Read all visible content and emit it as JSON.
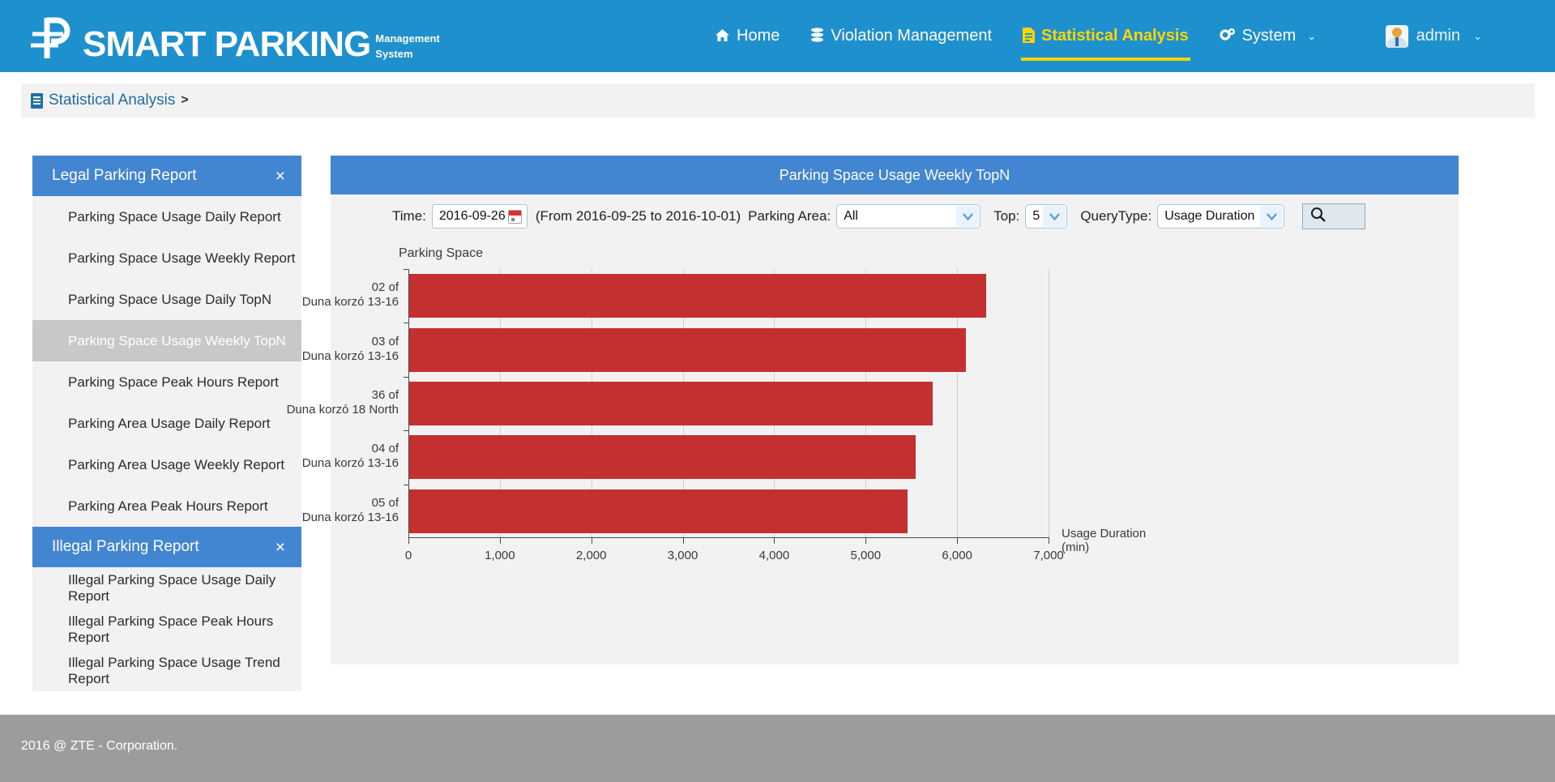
{
  "brand": {
    "title": "SMART PARKING",
    "subtitle_line1": "Management",
    "subtitle_line2": "System",
    "logo_icon": "parking-p-logo-icon"
  },
  "nav": {
    "items": [
      {
        "label": "Home",
        "icon": "home-icon",
        "active": false,
        "caret": ""
      },
      {
        "label": "Violation Management",
        "icon": "database-icon",
        "active": false,
        "caret": ""
      },
      {
        "label": "Statistical Analysis",
        "icon": "document-icon",
        "active": true,
        "caret": ""
      },
      {
        "label": "System",
        "icon": "gears-icon",
        "active": false,
        "caret": "⌄"
      }
    ],
    "user": {
      "name": "admin",
      "caret": "⌄",
      "icon": "user-avatar-icon"
    }
  },
  "breadcrumb": {
    "icon": "document-icon",
    "label": "Statistical Analysis",
    "separator": ">"
  },
  "sidebar": {
    "groups": [
      {
        "title": "Legal Parking Report",
        "close_label": "×",
        "items": [
          {
            "label": "Parking Space Usage Daily Report",
            "selected": false
          },
          {
            "label": "Parking Space Usage Weekly Report",
            "selected": false
          },
          {
            "label": "Parking Space Usage Daily TopN",
            "selected": false
          },
          {
            "label": "Parking Space Usage Weekly TopN",
            "selected": true
          },
          {
            "label": "Parking Space Peak Hours Report",
            "selected": false
          },
          {
            "label": "Parking Area Usage Daily Report",
            "selected": false
          },
          {
            "label": "Parking Area Usage Weekly Report",
            "selected": false
          },
          {
            "label": "Parking Area Peak Hours Report",
            "selected": false
          }
        ]
      },
      {
        "title": "Illegal Parking Report",
        "close_label": "×",
        "items": [
          {
            "label": "Illegal Parking Space Usage Daily Report",
            "selected": false
          },
          {
            "label": "Illegal Parking Space Peak Hours Report",
            "selected": false
          },
          {
            "label": "Illegal Parking Space Usage Trend Report",
            "selected": false
          }
        ]
      }
    ]
  },
  "panel": {
    "title": "Parking Space Usage Weekly TopN",
    "toolbar": {
      "time_label": "Time:",
      "time_value": "2016-09-26",
      "calendar_icon": "calendar-icon",
      "range_text": "(From 2016-09-25 to 2016-10-01)",
      "area_label": "Parking Area:",
      "area_value": "All",
      "top_label": "Top:",
      "top_value": "5",
      "querytype_label": "QueryType:",
      "querytype_value": "Usage Duration",
      "search_icon": "search-icon"
    }
  },
  "chart_data": {
    "type": "bar",
    "orientation": "horizontal",
    "title": "Parking Space Usage Weekly TopN",
    "ylabel": "Parking Space",
    "xlabel": "Usage Duration(min)",
    "xlabel_line1": "Usage Duration",
    "xlabel_line2": "(min)",
    "xlim": [
      0,
      7000
    ],
    "xticks": [
      0,
      1000,
      2000,
      3000,
      4000,
      5000,
      6000,
      7000
    ],
    "xtick_labels": [
      "0",
      "1,000",
      "2,000",
      "3,000",
      "4,000",
      "5,000",
      "6,000",
      "7,000"
    ],
    "grid": true,
    "legend": "none",
    "bar_color": "#c43030",
    "categories": [
      "02 of\nDuna korzó 13-16",
      "03 of\nDuna korzó 13-16",
      "36 of\nDuna korzó 18 North",
      "04 of\nDuna korzó 13-16",
      "05 of\nDuna korzó 13-16"
    ],
    "category_lines": [
      [
        "02 of",
        "Duna korzó 13-16"
      ],
      [
        "03 of",
        "Duna korzó 13-16"
      ],
      [
        "36 of",
        "Duna korzó 18 North"
      ],
      [
        "04 of",
        "Duna korzó 13-16"
      ],
      [
        "05 of",
        "Duna korzó 13-16"
      ]
    ],
    "values": [
      6310,
      6090,
      5720,
      5540,
      5450
    ]
  },
  "footer": {
    "text": "2016 @ ZTE - Corporation."
  },
  "colors": {
    "header_blue": "#1e90ce",
    "panel_blue": "#4285d0",
    "accent_yellow": "#ffd400",
    "bar_red": "#c43030",
    "selected_gray": "#c8c8c8",
    "footer_gray": "#9c9c9c"
  }
}
